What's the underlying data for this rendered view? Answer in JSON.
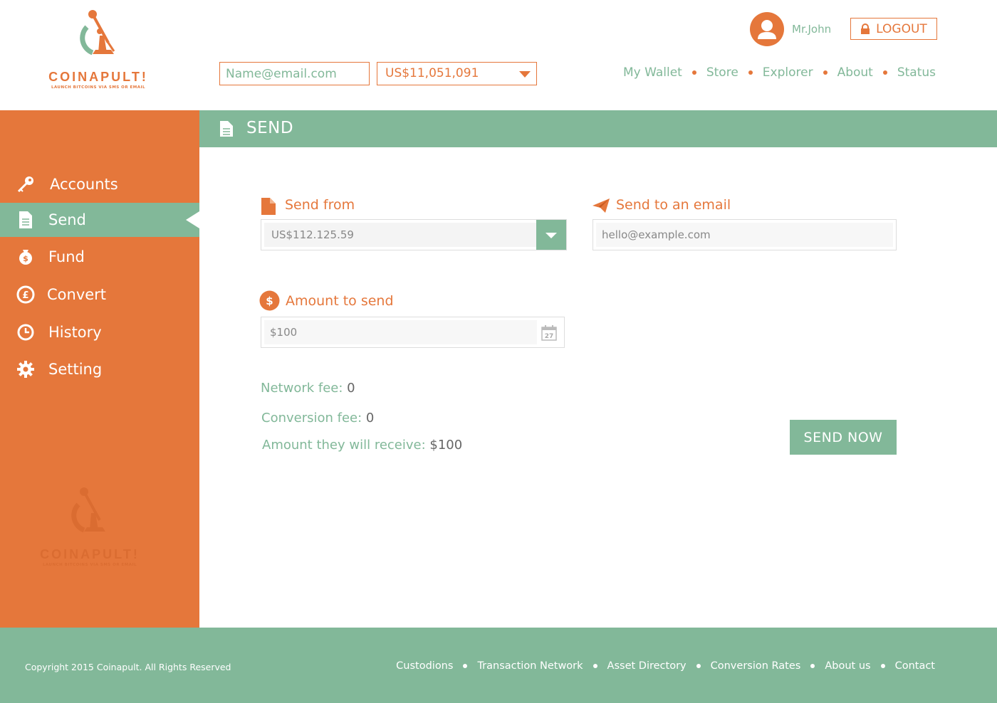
{
  "brand": {
    "name": "COINAPULT!",
    "tagline": "LAUNCH BITCOINS VIA SMS OR EMAIL",
    "accent": "#e5773b",
    "secondary": "#82b899"
  },
  "header": {
    "email_placeholder": "Name@email.com",
    "balance": "US$11,051,091",
    "nav": [
      "My Wallet",
      "Store",
      "Explorer",
      "About",
      "Status"
    ],
    "username": "Mr.John",
    "logout_label": "LOGOUT"
  },
  "sidebar": {
    "active": "Send",
    "items": [
      {
        "label": "Accounts",
        "icon": "key-icon"
      },
      {
        "label": "Send",
        "icon": "document-icon"
      },
      {
        "label": "Fund",
        "icon": "money-bag-icon"
      },
      {
        "label": "Convert",
        "icon": "currency-exchange-icon"
      },
      {
        "label": "History",
        "icon": "clock-icon"
      },
      {
        "label": "Setting",
        "icon": "gear-icon"
      }
    ]
  },
  "main": {
    "title": "SEND",
    "send_from": {
      "label": "Send from",
      "value": "US$112.125.59"
    },
    "send_to": {
      "label": "Send to an email",
      "placeholder": "hello@example.com"
    },
    "amount": {
      "label": "Amount to send",
      "placeholder": "$100",
      "calendar_day": "27"
    },
    "fees": {
      "network_label": "Network fee:",
      "network_value": "0",
      "conversion_label": "Conversion fee:",
      "conversion_value": "0",
      "receive_label": "Amount they will receive:",
      "receive_value": "$100"
    },
    "send_button": "SEND NOW"
  },
  "footer": {
    "copyright": "Copyright 2015 Coinapult. All Rights Reserved",
    "links": [
      "Custodions",
      "Transaction Network",
      "Asset Directory",
      "Conversion Rates",
      "About us",
      "Contact"
    ]
  }
}
